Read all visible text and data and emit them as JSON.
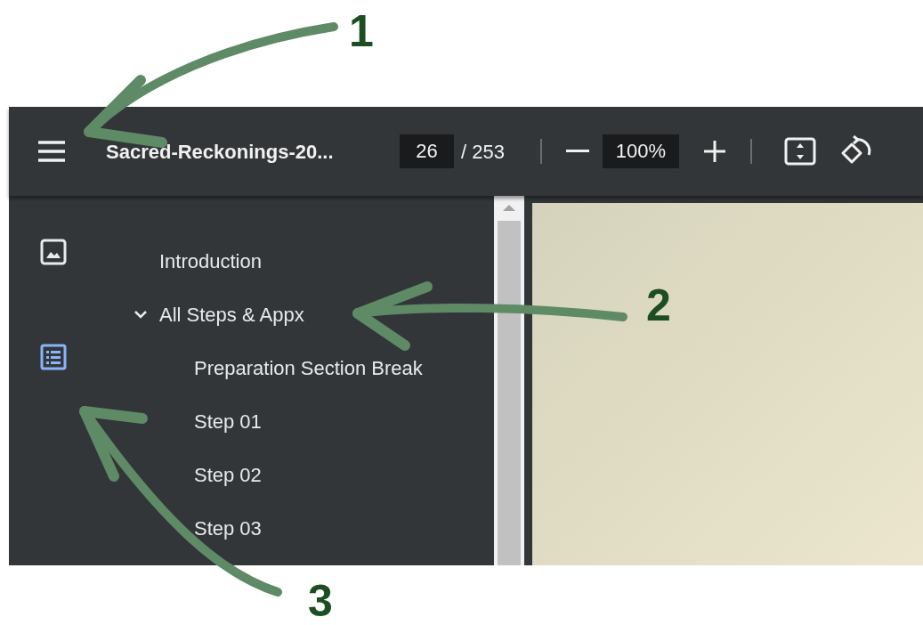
{
  "annotations": [
    {
      "label": "1"
    },
    {
      "label": "2"
    },
    {
      "label": "3"
    }
  ],
  "toolbar": {
    "title": "Sacred-Reckonings-20...",
    "page": "26",
    "page_count": "/ 253",
    "zoom": "100%"
  },
  "sidebar_tabs": [
    {
      "kind": "thumbnails",
      "selected": false
    },
    {
      "kind": "outline",
      "selected": true
    }
  ],
  "outline": [
    {
      "label": "Introduction"
    },
    {
      "label": "All Steps & Appx",
      "expanded": true,
      "children": [
        {
          "label": "Preparation Section Break"
        },
        {
          "label": "Step 01"
        },
        {
          "label": "Step 02"
        },
        {
          "label": "Step 03"
        }
      ]
    }
  ]
}
